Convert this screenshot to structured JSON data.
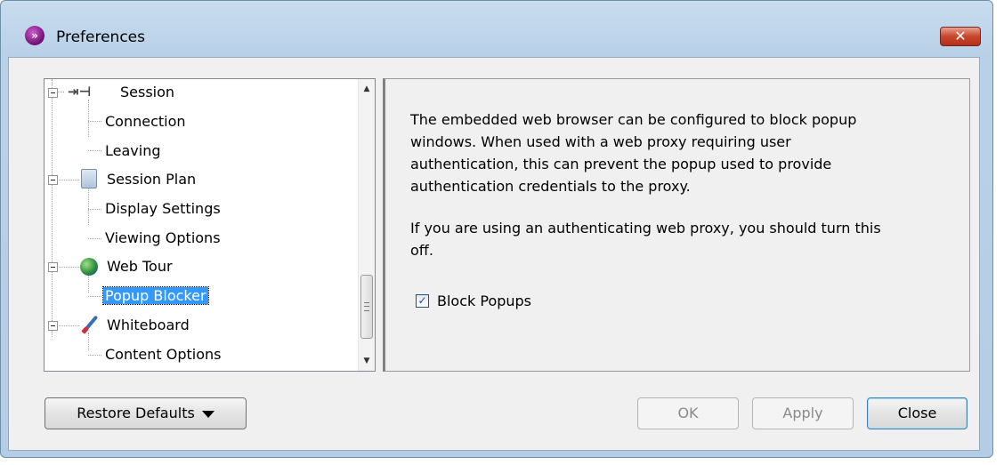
{
  "window": {
    "title": "Preferences",
    "close_glyph": "✕",
    "app_icon": "app-logo-icon"
  },
  "tree": {
    "items": [
      {
        "label": "Session",
        "level": 0,
        "icon": "plug-icon"
      },
      {
        "label": "Connection",
        "level": 1
      },
      {
        "label": "Leaving",
        "level": 1
      },
      {
        "label": "Session Plan",
        "level": 0,
        "icon": "clipboard-icon"
      },
      {
        "label": "Display Settings",
        "level": 1
      },
      {
        "label": "Viewing Options",
        "level": 1
      },
      {
        "label": "Web Tour",
        "level": 0,
        "icon": "globe-icon"
      },
      {
        "label": "Popup Blocker",
        "level": 1,
        "selected": true
      },
      {
        "label": "Whiteboard",
        "level": 0,
        "icon": "brush-icon"
      },
      {
        "label": "Content Options",
        "level": 1
      }
    ],
    "scroll_up": "▲",
    "scroll_down": "▼"
  },
  "content": {
    "para1_lines": [
      "The embedded web browser can be configured to block popup",
      "windows. When used with a web proxy requiring user",
      "authentication, this can prevent the popup used to provide",
      "authentication credentials to the proxy."
    ],
    "para2_lines": [
      "If you are using an authenticating web proxy, you should turn this",
      "off."
    ],
    "checkbox": {
      "label": "Block Popups",
      "checked": true,
      "check_glyph": "✓"
    }
  },
  "buttons": {
    "restore_defaults": "Restore Defaults",
    "ok": "OK",
    "apply": "Apply",
    "close": "Close"
  }
}
